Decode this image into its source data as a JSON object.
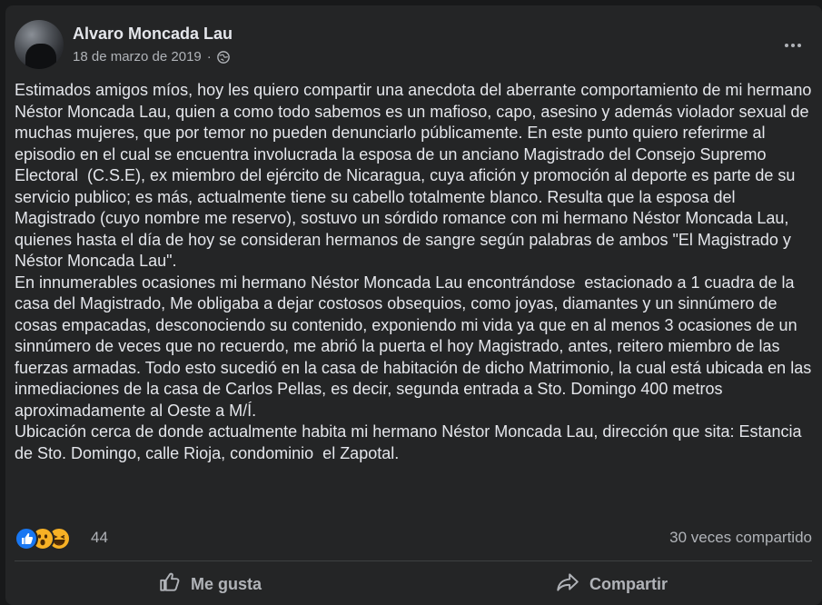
{
  "post": {
    "author": "Alvaro Moncada Lau",
    "date": "18 de marzo de 2019",
    "separator": "·",
    "privacy_icon": "globe-icon",
    "text": "Estimados amigos míos, hoy les quiero compartir una anecdota del aberrante comportamiento de mi hermano Néstor Moncada Lau, quien a como todo sabemos es un mafioso, capo, asesino y además violador sexual de muchas mujeres, que por temor no pueden denunciarlo públicamente. En este punto quiero referirme al episodio en el cual se encuentra involucrada la esposa de un anciano Magistrado del Consejo Supremo Electoral  (C.S.E), ex miembro del ejército de Nicaragua, cuya afición y promoción al deporte es parte de su servicio publico; es más, actualmente tiene su cabello totalmente blanco. Resulta que la esposa del Magistrado (cuyo nombre me reservo), sostuvo un sórdido romance con mi hermano Néstor Moncada Lau, quienes hasta el día de hoy se consideran hermanos de sangre según palabras de ambos \"El Magistrado y Néstor Moncada Lau\".\nEn innumerables ocasiones mi hermano Néstor Moncada Lau encontrándose  estacionado a 1 cuadra de la casa del Magistrado, Me obligaba a dejar costosos obsequios, como joyas, diamantes y un sinnúmero de cosas empacadas, desconociendo su contenido, exponiendo mi vida ya que en al menos 3 ocasiones de un sinnúmero de veces que no recuerdo, me abrió la puerta el hoy Magistrado, antes, reitero miembro de las fuerzas armadas. Todo esto sucedió en la casa de habitación de dicho Matrimonio, la cual está ubicada en las inmediaciones de la casa de Carlos Pellas, es decir, segunda entrada a Sto. Domingo 400 metros aproximadamente al Oeste a M/Í.\nUbicación cerca de donde actualmente habita mi hermano Néstor Moncada Lau, dirección que sita: Estancia de Sto. Domingo, calle Rioja, condominio  el Zapotal."
  },
  "reactions": {
    "icons": [
      "like-icon",
      "wow-icon",
      "haha-icon"
    ],
    "count": "44",
    "shares": "30 veces compartido"
  },
  "actions": {
    "like_label": "Me gusta",
    "share_label": "Compartir"
  },
  "colors": {
    "background": "#18191a",
    "card": "#242526",
    "text_primary": "#e4e6eb",
    "text_secondary": "#b0b3b8",
    "like_blue": "#1877f2",
    "emoji_yellow": "#f7b125"
  }
}
